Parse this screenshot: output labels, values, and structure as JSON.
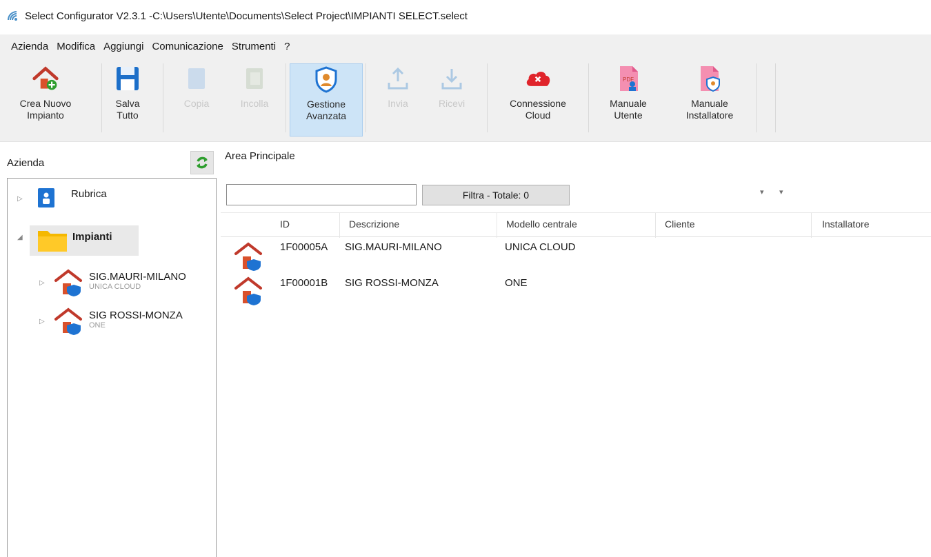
{
  "window": {
    "title": "Select Configurator V2.3.1 -C:\\Users\\Utente\\Documents\\Select Project\\IMPIANTI SELECT.select"
  },
  "menu": [
    "Azienda",
    "Modifica",
    "Aggiungi",
    "Comunicazione",
    "Strumenti",
    "?"
  ],
  "toolbar": {
    "crea_nuovo": "Crea Nuovo\nImpianto",
    "salva": "Salva\nTutto",
    "copia": "Copia",
    "incolla": "Incolla",
    "gestione": "Gestione\nAvanzata",
    "invia": "Invia",
    "ricevi": "Ricevi",
    "connessione": "Connessione\nCloud",
    "manuale_utente": "Manuale\nUtente",
    "manuale_installatore": "Manuale\nInstallatore"
  },
  "left_panel": {
    "title": "Azienda",
    "tree": {
      "rubrica": "Rubrica",
      "impianti": "Impianti",
      "children": [
        {
          "name": "SIG.MAURI-MILANO",
          "model": "UNICA CLOUD"
        },
        {
          "name": "SIG ROSSI-MONZA",
          "model": "ONE"
        }
      ]
    }
  },
  "main": {
    "title": "Area Principale",
    "filter_value": "",
    "filter_button": "Filtra - Totale: 0",
    "columns": [
      "ID",
      "Descrizione",
      "Modello centrale",
      "Cliente",
      "Installatore"
    ],
    "rows": [
      {
        "id": "1F00005A",
        "descrizione": "SIG.MAURI-MILANO",
        "modello": "UNICA CLOUD",
        "cliente": "",
        "installatore": ""
      },
      {
        "id": "1F00001B",
        "descrizione": "SIG ROSSI-MONZA",
        "modello": "ONE",
        "cliente": "",
        "installatore": ""
      }
    ]
  },
  "colors": {
    "house_roof": "#c0392b",
    "shield_blue": "#1e73d2",
    "cloud_red": "#e0242b",
    "save_blue": "#1c6fc9",
    "refresh_green": "#2e9e2e",
    "folder_yellow": "#f5b800",
    "active_tool_bg": "#cde4f7"
  }
}
